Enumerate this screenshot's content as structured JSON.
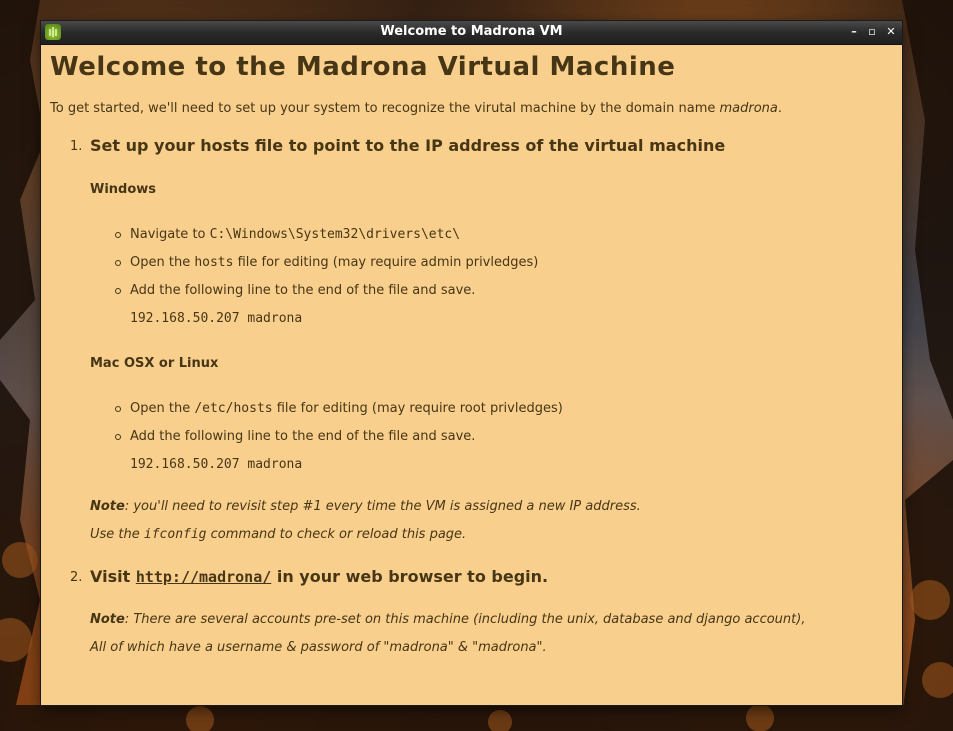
{
  "window": {
    "title": "Welcome to Madrona VM",
    "minimize": "–",
    "maximize": "▫",
    "close": "✕"
  },
  "page": {
    "heading": "Welcome to the Madrona Virtual Machine",
    "intro_text": "To get started, we'll need to set up your system to recognize the virutal machine by the domain name ",
    "intro_domain": "madrona",
    "intro_end": ".",
    "step1": {
      "number": "1.",
      "title": "Set up your hosts file to point to the IP address of the virtual machine",
      "windows": {
        "heading": "Windows",
        "item1_pre": "Navigate to ",
        "item1_code": "C:\\Windows\\System32\\drivers\\etc\\",
        "item2_pre": "Open the ",
        "item2_code": "hosts",
        "item2_post": " file for editing (may require admin privledges)",
        "item3": "Add the following line to the end of the file and save.",
        "hosts_line": "192.168.50.207 madrona"
      },
      "mac": {
        "heading": "Mac OSX or Linux",
        "item1_pre": "Open the ",
        "item1_code": "/etc/hosts",
        "item1_post": " file for editing (may require root privledges)",
        "item2": "Add the following line to the end of the file and save.",
        "hosts_line": "192.168.50.207 madrona"
      },
      "note_label": "Note",
      "note_text": ": you'll need to revisit step #1 every time the VM is assigned a new IP address.",
      "note2_pre": "Use the ",
      "note2_code": "ifconfig",
      "note2_post": " command to check or reload this page."
    },
    "step2": {
      "number": "2.",
      "pre": "Visit ",
      "link": "http://madrona/",
      "post": " in your web browser to begin.",
      "note_label": "Note",
      "note_text": ": There are several accounts pre-set on this machine (including the unix, database and django account),",
      "note2": "All of which have a username & password of \"madrona\" & \"madrona\"."
    }
  }
}
